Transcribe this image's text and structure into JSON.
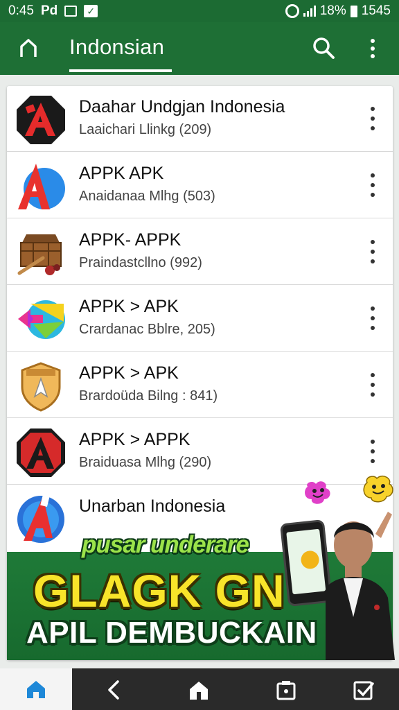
{
  "status_bar": {
    "time": "0:45",
    "carrier": "Pd",
    "battery_percent": "18%",
    "right_number": "1545"
  },
  "app_bar": {
    "title": "Indonsian",
    "icons": [
      "home-outline-icon",
      "search-icon",
      "more-vert-icon"
    ]
  },
  "apps": [
    {
      "name": "Daahar Undgjan Indonesia",
      "sub": "Laaichari Llinkg (209)",
      "icon": "red-a-octagon-icon"
    },
    {
      "name": "APPK APK",
      "sub": "Anaidanaa Mlhg (503)",
      "icon": "red-blue-a-logo-icon"
    },
    {
      "name": "APPK- APPK",
      "sub": "Praindastcllno (992)",
      "icon": "wooden-chest-icon"
    },
    {
      "name": "APPK > APK",
      "sub": "Crardanac Bblre, 205)",
      "icon": "colorful-arrow-icon"
    },
    {
      "name": "APPK > APK",
      "sub": "Brardoüda Bilng : 841)",
      "icon": "shield-rocket-icon"
    },
    {
      "name": "APPK > APPK",
      "sub": "Braiduasa Mlhg (290)",
      "icon": "red-a-octagon-icon"
    },
    {
      "name": "Unarban Indonesia",
      "sub": "",
      "icon": "blue-a-circle-icon"
    }
  ],
  "promo": {
    "tag": "pusar underare",
    "headline": "GLAGK GN",
    "subline": "APIL DEMBUCKAIN"
  },
  "bottom_nav": [
    "home-icon",
    "back-icon",
    "house-icon",
    "recents-icon",
    "task-icon"
  ],
  "colors": {
    "primary": "#1e6f35",
    "promo_yellow": "#f8e42a",
    "promo_green_text": "#9be34a"
  }
}
